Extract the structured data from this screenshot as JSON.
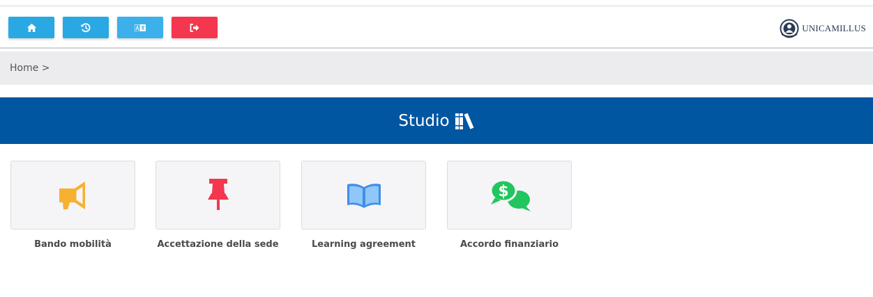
{
  "navbar": {
    "buttons": [
      {
        "name": "home",
        "icon": "home-icon",
        "color": "#2aa8e3"
      },
      {
        "name": "history",
        "icon": "history-icon",
        "color": "#2aa8e3"
      },
      {
        "name": "language",
        "icon": "language-icon",
        "color": "#3cb0ea"
      },
      {
        "name": "logout",
        "icon": "logout-icon",
        "color": "#f4364e"
      }
    ],
    "logo_text": "UNICAMILLUS"
  },
  "breadcrumb": {
    "text": "Home >"
  },
  "section": {
    "title": "Studio",
    "icon": "books-icon",
    "background": "#0056a0"
  },
  "cards": [
    {
      "label": "Bando mobilità",
      "icon": "megaphone-icon",
      "icon_color": "#f7b030"
    },
    {
      "label": "Accettazione della sede",
      "icon": "pushpin-icon",
      "icon_color": "#f4364e"
    },
    {
      "label": "Learning agreement",
      "icon": "open-book-icon",
      "icon_color": "#3f8ee8"
    },
    {
      "label": "Accordo finanziario",
      "icon": "money-chat-icon",
      "icon_color": "#22c55e"
    }
  ]
}
